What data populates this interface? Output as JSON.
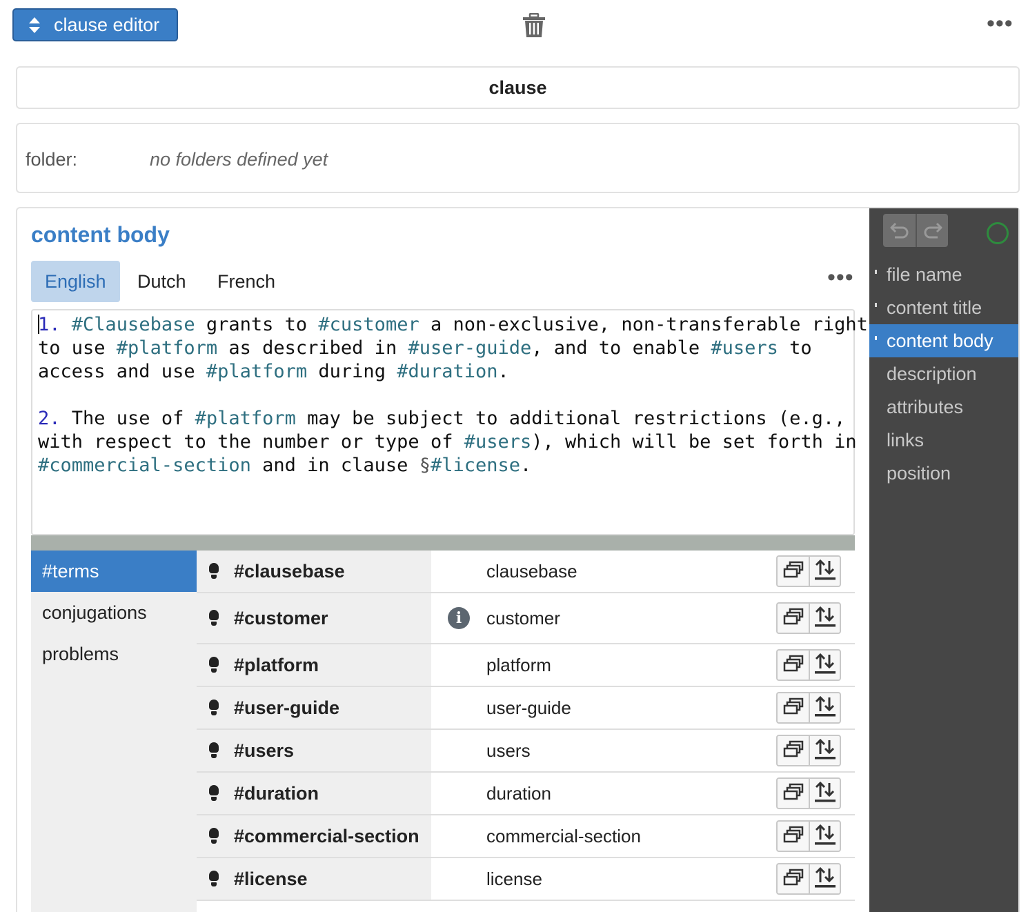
{
  "toolbar": {
    "mode_label": "clause editor"
  },
  "clause_header": {
    "title": "clause"
  },
  "folder": {
    "label": "folder:",
    "value": "no folders defined yet"
  },
  "content_body": {
    "title": "content body",
    "languages": [
      "English",
      "Dutch",
      "French"
    ],
    "active_language": "English",
    "paragraph1": [
      {
        "t": "1.",
        "k": "num"
      },
      {
        "t": " ",
        "k": "txt"
      },
      {
        "t": "#Clausebase",
        "k": "term"
      },
      {
        "t": " grants to ",
        "k": "txt"
      },
      {
        "t": "#customer",
        "k": "term"
      },
      {
        "t": " a non-exclusive, non-transferable right\nto use ",
        "k": "txt"
      },
      {
        "t": "#platform",
        "k": "term"
      },
      {
        "t": " as described in ",
        "k": "txt"
      },
      {
        "t": "#user-guide",
        "k": "term"
      },
      {
        "t": ", and to enable ",
        "k": "txt"
      },
      {
        "t": "#users",
        "k": "term"
      },
      {
        "t": " to\naccess and use ",
        "k": "txt"
      },
      {
        "t": "#platform",
        "k": "term"
      },
      {
        "t": " during ",
        "k": "txt"
      },
      {
        "t": "#duration",
        "k": "term"
      },
      {
        "t": ".",
        "k": "txt"
      }
    ],
    "paragraph2": [
      {
        "t": "2.",
        "k": "num"
      },
      {
        "t": " The use of ",
        "k": "txt"
      },
      {
        "t": "#platform",
        "k": "term"
      },
      {
        "t": " may be subject to additional restrictions (e.g.,\nwith respect to the number or type of ",
        "k": "txt"
      },
      {
        "t": "#users",
        "k": "term"
      },
      {
        "t": "), which will be set forth in\n",
        "k": "txt"
      },
      {
        "t": "#commercial-section",
        "k": "term"
      },
      {
        "t": " and in clause ",
        "k": "txt"
      },
      {
        "t": "§",
        "k": "sec"
      },
      {
        "t": "#license",
        "k": "term"
      },
      {
        "t": ".",
        "k": "txt"
      }
    ]
  },
  "bottom_panel": {
    "tabs": [
      "#terms",
      "conjugations",
      "problems"
    ],
    "active_tab": "#terms",
    "terms": [
      {
        "name": "#clausebase",
        "value": "clausebase",
        "info": false
      },
      {
        "name": "#customer",
        "value": "customer",
        "info": true
      },
      {
        "name": "#platform",
        "value": "platform",
        "info": false
      },
      {
        "name": "#user-guide",
        "value": "user-guide",
        "info": false
      },
      {
        "name": "#users",
        "value": "users",
        "info": false
      },
      {
        "name": "#duration",
        "value": "duration",
        "info": false
      },
      {
        "name": "#commercial-section",
        "value": "commercial-section",
        "info": false
      },
      {
        "name": "#license",
        "value": "license",
        "info": false
      }
    ]
  },
  "sidebar": {
    "items": [
      {
        "label": "file name",
        "marker": true
      },
      {
        "label": "content title",
        "marker": true
      },
      {
        "label": "content body",
        "marker": true,
        "active": true
      },
      {
        "label": "description",
        "marker": false
      },
      {
        "label": "attributes",
        "marker": false
      },
      {
        "label": "links",
        "marker": false
      },
      {
        "label": "position",
        "marker": false
      }
    ],
    "status_color": "#2e8b3e"
  },
  "colors": {
    "accent": "#3a7ec6",
    "term": "#2e6f80",
    "number": "#2a2ab8"
  }
}
